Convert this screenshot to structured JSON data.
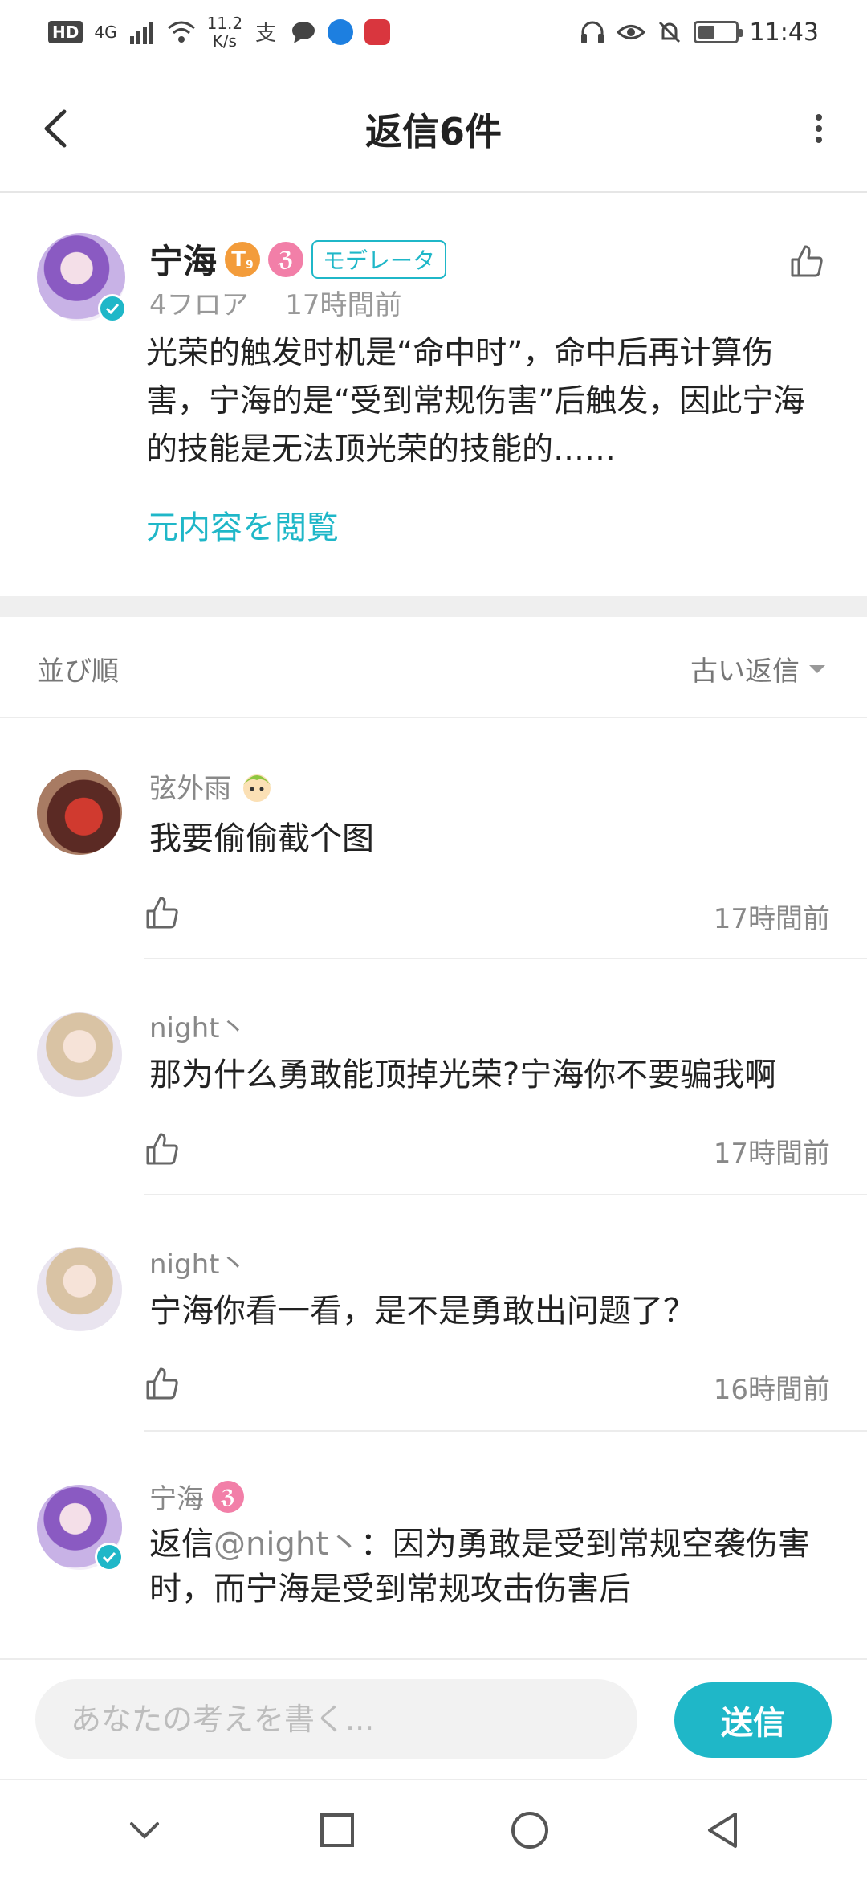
{
  "status_bar": {
    "hd": "HD",
    "network": "4G",
    "speed_value": "11.2",
    "speed_unit": "K/s",
    "time": "11:43",
    "battery_level": 0.4
  },
  "header": {
    "title": "返信6件"
  },
  "original_post": {
    "author": "宁海",
    "level_badge": "T",
    "level_sub": "9",
    "role_badge": "モデレータ",
    "floor": "4フロア",
    "time": "17時間前",
    "body": "光荣的触发时机是“命中时”，命中后再计算伤害，宁海的是“受到常规伤害”后触发，因此宁海的技能是无法顶光荣的技能的……",
    "view_original": "元内容を閲覧"
  },
  "sort": {
    "label": "並び順",
    "value": "古い返信"
  },
  "replies": [
    {
      "author": "弦外雨",
      "text": "我要偷偷截个图",
      "time": "17時間前"
    },
    {
      "author": "night丶",
      "text": "那为什么勇敢能顶掉光荣?宁海你不要骗我啊",
      "time": "17時間前"
    },
    {
      "author": "night丶",
      "text": "宁海你看一看，是不是勇敢出问题了？",
      "time": "16時間前"
    },
    {
      "author": "宁海",
      "reply_prefix": "返信",
      "mention": "@night丶",
      "text": "：因为勇敢是受到常规空袭伤害时，而宁海是受到常规攻击伤害后"
    }
  ],
  "composer": {
    "placeholder": "あなたの考えを書く...",
    "send_label": "送信"
  },
  "colors": {
    "accent": "#1fb7c8",
    "level_badge": "#f39c3b",
    "pink_badge": "#f27fa8"
  }
}
